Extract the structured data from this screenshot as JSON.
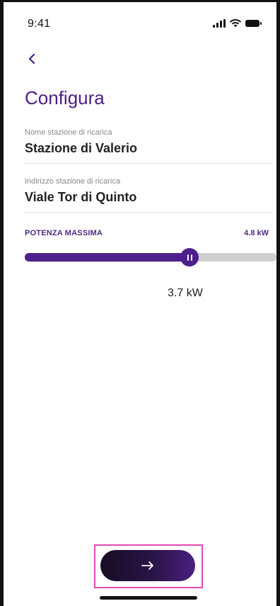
{
  "status_bar": {
    "time": "9:41"
  },
  "header": {
    "title": "Configura"
  },
  "fields": [
    {
      "label": "Nome stazione di ricarica",
      "value": "Stazione di Valerio"
    },
    {
      "label": "Indirizzo stazione di ricarica",
      "value": "Viale Tor di Quinto"
    }
  ],
  "power": {
    "label": "POTENZA MASSIMA",
    "max_label": "4.8 kW",
    "value_label": "3.7 kW",
    "fill_fraction": 0.655
  },
  "colors": {
    "accent": "#4d1f8a",
    "title": "#4b1e86",
    "track": "#cfcfcf",
    "highlight": "#e24ab3"
  },
  "icons": {
    "back": "chevron-left-icon",
    "next": "arrow-right-icon"
  }
}
